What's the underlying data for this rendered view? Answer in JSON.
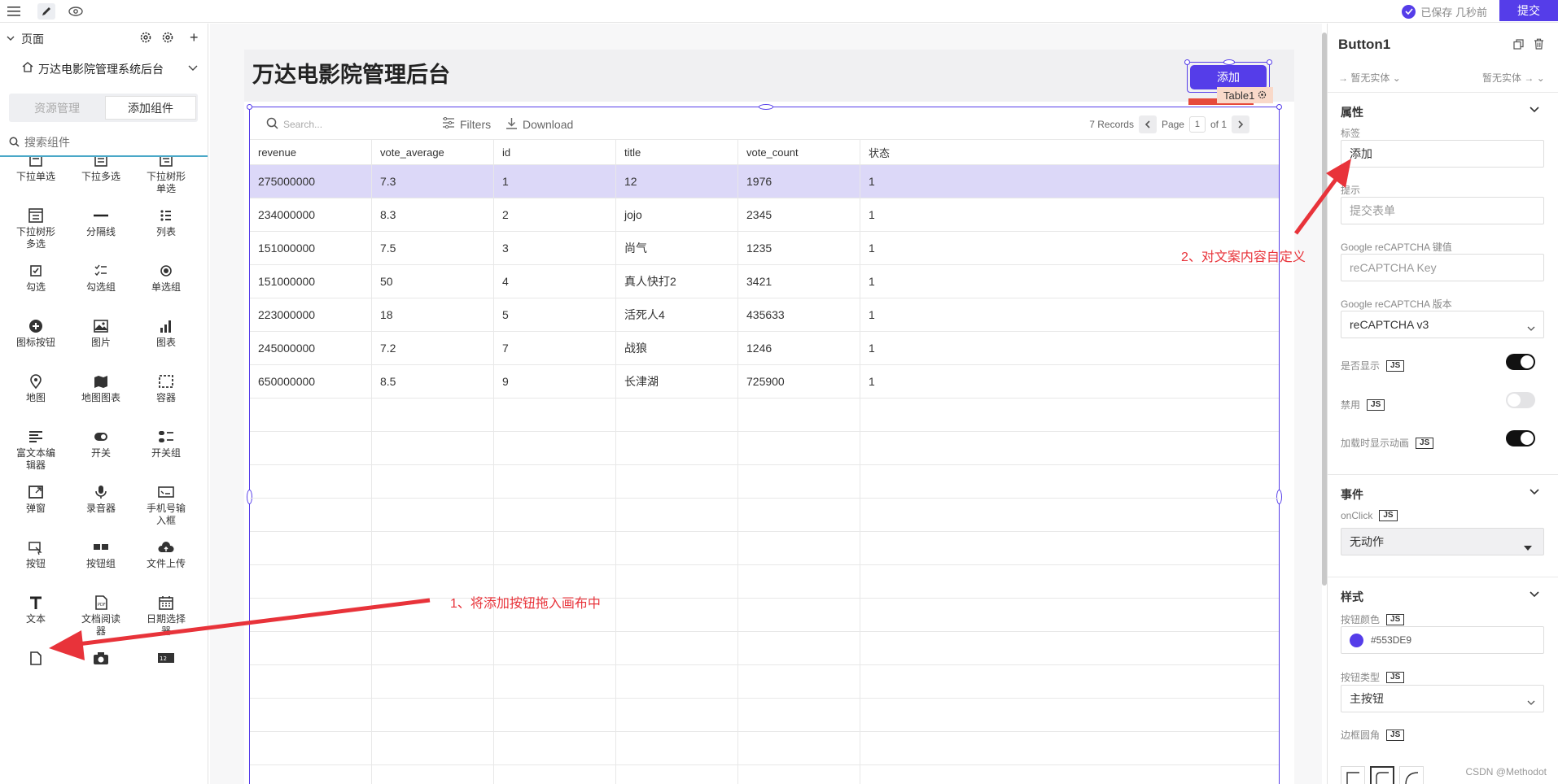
{
  "topbar": {
    "saved_text": "已保存 几秒前",
    "submit_label": "提交"
  },
  "left": {
    "pages_label": "页面",
    "page_name": "万达电影院管理系统后台",
    "tabs": [
      "资源管理",
      "添加组件"
    ],
    "search_placeholder": "搜索组件",
    "widgets": [
      {
        "label": "下拉单选",
        "icon": "select-icon"
      },
      {
        "label": "下拉多选",
        "icon": "multiselect-icon"
      },
      {
        "label": "下拉树形单选",
        "icon": "tree-select-icon"
      },
      {
        "label": "下拉树形多选",
        "icon": "tree-multiselect-icon"
      },
      {
        "label": "分隔线",
        "icon": "divider-icon"
      },
      {
        "label": "列表",
        "icon": "list-icon"
      },
      {
        "label": "勾选",
        "icon": "checkbox-icon"
      },
      {
        "label": "勾选组",
        "icon": "checkbox-group-icon"
      },
      {
        "label": "单选组",
        "icon": "radio-group-icon"
      },
      {
        "label": "图标按钮",
        "icon": "icon-button-icon"
      },
      {
        "label": "图片",
        "icon": "image-icon"
      },
      {
        "label": "图表",
        "icon": "chart-icon"
      },
      {
        "label": "地图",
        "icon": "map-pin-icon"
      },
      {
        "label": "地图图表",
        "icon": "map-chart-icon"
      },
      {
        "label": "容器",
        "icon": "container-icon"
      },
      {
        "label": "富文本编辑器",
        "icon": "rich-text-icon"
      },
      {
        "label": "开关",
        "icon": "switch-icon"
      },
      {
        "label": "开关组",
        "icon": "switch-group-icon"
      },
      {
        "label": "弹窗",
        "icon": "modal-icon"
      },
      {
        "label": "录音器",
        "icon": "microphone-icon"
      },
      {
        "label": "手机号输入框",
        "icon": "phone-input-icon"
      },
      {
        "label": "按钮",
        "icon": "button-icon"
      },
      {
        "label": "按钮组",
        "icon": "button-group-icon"
      },
      {
        "label": "文件上传",
        "icon": "upload-icon"
      },
      {
        "label": "文本",
        "icon": "text-icon"
      },
      {
        "label": "文档阅读器",
        "icon": "pdf-icon"
      },
      {
        "label": "日期选择器",
        "icon": "calendar-icon"
      },
      {
        "label": "",
        "icon": "file-icon"
      },
      {
        "label": "",
        "icon": "camera-icon"
      },
      {
        "label": "",
        "icon": "number-icon"
      }
    ]
  },
  "canvas": {
    "app_title": "万达电影院管理后台",
    "add_button_label": "添加",
    "table_tag": "Table1",
    "table": {
      "search_placeholder": "Search...",
      "filters_label": "Filters",
      "download_label": "Download",
      "records_text": "7 Records",
      "page_label": "Page",
      "page_num": "1",
      "of_text": "of 1",
      "columns": [
        "revenue",
        "vote_average",
        "id",
        "title",
        "vote_count",
        "状态"
      ],
      "rows": [
        [
          "275000000",
          "7.3",
          "1",
          "12",
          "1976",
          "1"
        ],
        [
          "234000000",
          "8.3",
          "2",
          "jojo",
          "2345",
          "1"
        ],
        [
          "151000000",
          "7.5",
          "3",
          "尚气",
          "1235",
          "1"
        ],
        [
          "151000000",
          "50",
          "4",
          "真人快打2",
          "3421",
          "1"
        ],
        [
          "223000000",
          "18",
          "5",
          "活死人4",
          "435633",
          "1"
        ],
        [
          "245000000",
          "7.2",
          "7",
          "战狼",
          "1246",
          "1"
        ],
        [
          "650000000",
          "8.5",
          "9",
          "长津湖",
          "725900",
          "1"
        ]
      ]
    }
  },
  "annotations": {
    "step1": "1、将添加按钮拖入画布中",
    "step2": "2、对文案内容自定义"
  },
  "right": {
    "component_name": "Button1",
    "entity_left": "暂无实体",
    "entity_right": "暂无实体",
    "sections": {
      "props": "属性",
      "events": "事件",
      "style": "样式"
    },
    "fields": {
      "label_label": "标签",
      "label_value": "添加",
      "hint_label": "提示",
      "hint_placeholder": "提交表单",
      "recaptcha_key_label": "Google reCAPTCHA 键值",
      "recaptcha_key_placeholder": "reCAPTCHA Key",
      "recaptcha_version_label": "Google reCAPTCHA 版本",
      "recaptcha_version_value": "reCAPTCHA v3",
      "visible_label": "是否显示",
      "disabled_label": "禁用",
      "loading_label": "加载时显示动画",
      "onclick_label": "onClick",
      "onclick_value": "无动作",
      "button_color_label": "按钮颜色",
      "button_color_value": "#553DE9",
      "button_type_label": "按钮类型",
      "button_type_value": "主按钮",
      "border_radius_label": "边框圆角",
      "js_tag": "JS"
    },
    "toggles": {
      "visible": true,
      "disabled": false,
      "loading": true
    }
  },
  "colors": {
    "accent": "#553DE9",
    "annotation": "#E8333A"
  },
  "watermark": "CSDN @Methodot"
}
